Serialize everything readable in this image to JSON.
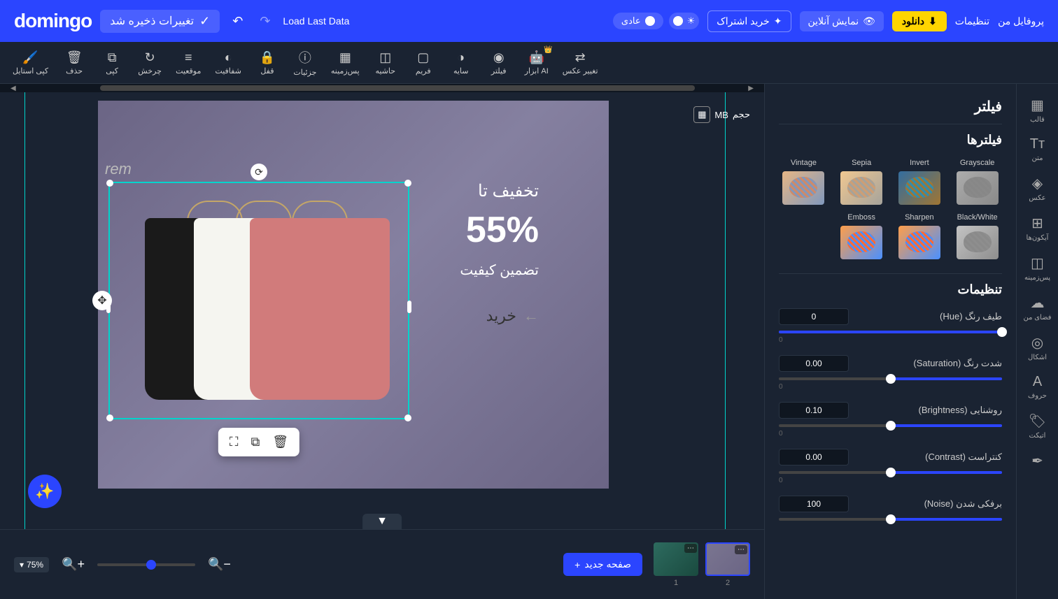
{
  "topbar": {
    "logo": "domingo",
    "saved": "تغییرات ذخیره شد",
    "load_last": "Load Last Data",
    "mode_label": "عادی",
    "subscribe": "خرید اشتراک",
    "preview": "نمایش آنلاین",
    "download": "دانلود",
    "settings": "تنظیمات",
    "profile": "پروفایل من"
  },
  "toolbar": [
    {
      "label": "کپی استایل",
      "icon": "🖌️"
    },
    {
      "label": "حذف",
      "icon": "🗑"
    },
    {
      "label": "کپی",
      "icon": "⧉"
    },
    {
      "label": "چرخش",
      "icon": "↻"
    },
    {
      "label": "موقعیت",
      "icon": "≡"
    },
    {
      "label": "شفافیت",
      "icon": "◐"
    },
    {
      "label": "قفل",
      "icon": "🔒"
    },
    {
      "label": "جزئیات",
      "icon": "ⓘ"
    },
    {
      "label": "پس‌زمینه",
      "icon": "▦"
    },
    {
      "label": "حاشیه",
      "icon": "◫"
    },
    {
      "label": "فریم",
      "icon": "▢"
    },
    {
      "label": "سایه",
      "icon": "◑"
    },
    {
      "label": "فیلتر",
      "icon": "◉"
    },
    {
      "label": "ابزار AI",
      "icon": "🤖",
      "premium": true
    },
    {
      "label": "تغییر عکس",
      "icon": "⇄"
    }
  ],
  "canvas": {
    "size_label": "حجم",
    "size_unit": "MB",
    "text_line1": "تخفیف تا",
    "text_percent": "55%",
    "text_line2": "تضمین کیفیت",
    "text_cta": "خرید",
    "watermark": "rem"
  },
  "bottom": {
    "zoom": "75%",
    "new_page": "صفحه جدید",
    "page1": "1",
    "page2": "2"
  },
  "right_panel": {
    "title": "فیلتر",
    "filters_title": "فیلترها",
    "filters": [
      {
        "name": "Grayscale",
        "cls": "grayscale"
      },
      {
        "name": "Invert",
        "cls": "invert"
      },
      {
        "name": "Sepia",
        "cls": "sepia"
      },
      {
        "name": "Vintage",
        "cls": "vintage"
      },
      {
        "name": "Black/White",
        "cls": "bw"
      },
      {
        "name": "Sharpen",
        "cls": ""
      },
      {
        "name": "Emboss",
        "cls": ""
      }
    ],
    "settings_title": "تنظیمات",
    "settings": [
      {
        "label": "طیف رنگ (Hue)",
        "value": "0",
        "max": "0",
        "pos": 100
      },
      {
        "label": "شدت رنگ (Saturation)",
        "value": "0.00",
        "max": "0",
        "pos": 50
      },
      {
        "label": "روشنایی (Brightness)",
        "value": "0.10",
        "max": "0",
        "pos": 50
      },
      {
        "label": "کنتراست (Contrast)",
        "value": "0.00",
        "max": "0",
        "pos": 50
      },
      {
        "label": "برفکی شدن (Noise)",
        "value": "100",
        "max": "",
        "pos": 50
      }
    ]
  },
  "sidebar": [
    {
      "label": "قالب",
      "icon": "▦"
    },
    {
      "label": "متن",
      "icon": "Tᴛ"
    },
    {
      "label": "عکس",
      "icon": "◈"
    },
    {
      "label": "آیکون‌ها",
      "icon": "⊞"
    },
    {
      "label": "پس‌زمینه",
      "icon": "◫"
    },
    {
      "label": "فضای من",
      "icon": "☁"
    },
    {
      "label": "اشکال",
      "icon": "◎"
    },
    {
      "label": "حروف",
      "icon": "A"
    },
    {
      "label": "اتیکت",
      "icon": "🏷"
    },
    {
      "label": "",
      "icon": "✒"
    }
  ]
}
